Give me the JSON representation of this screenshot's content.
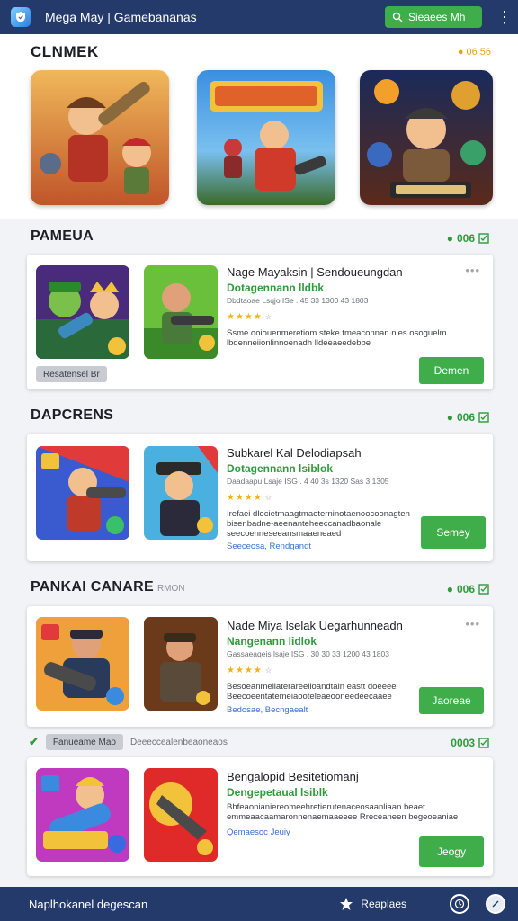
{
  "topbar": {
    "title": "Mega May | Gamebananas",
    "button_label": "Sieaees Mh",
    "menu_icon": "kebab-icon"
  },
  "featured": {
    "title": "CLNMEK",
    "count": "06 56"
  },
  "sections": [
    {
      "title": "PAMEUA",
      "subtitle": "",
      "badge": "006",
      "card": {
        "title": "Nage Mayaksin | Sendoueungdan",
        "sub": "Dotagennann lldbk",
        "meta": "Dbdtaoae Lsqjo  ISe . 45 33  1300  43 1803",
        "stars": "★★★★",
        "stars_count": "☆",
        "desc": "Ssme ooiouenmeretiom steke tmeaconnan nies osoguelm lbdenneiionlinnoenadh lldeeaeedebbe",
        "link": "",
        "button": "Demen",
        "pill": "Resatensel Br"
      }
    },
    {
      "title": "DAPCRENS",
      "subtitle": "",
      "badge": "006",
      "card": {
        "title": "Subkarel Kal Delodiapsah",
        "sub": "Dotagennann lsiblok",
        "meta": "Daadaapu  Lsaje ISG . 4 40 3s 1320  Sas 3 1305",
        "stars": "★★★★",
        "stars_count": "☆",
        "desc": "Irefaei dlocietmaagtmaeterninotaenoocoonagten bisenbadne-aeenanteheeccanadbaonale seecoenneseeansmaaeneaed",
        "link": "Seeceosa, Rendgandt",
        "button": "Semey",
        "pill": ""
      }
    },
    {
      "title": "PANKAI CANARE",
      "subtitle": "RMON",
      "badge": "006",
      "card": {
        "title": "Nade Miya lselak Uegarhunneadn",
        "sub": "Nangenann lidlok",
        "meta": "Gassaeaqeis  lsaje ISG . 30 30 33 1200  43 1803",
        "stars": "★★★★",
        "stars_count": "☆",
        "desc": "Besoeanmeliaterareelloandtain eastt doeeee Beecoeentatemeiaooteleaeooneedeecaaee",
        "link": "Bedosae, Becngaealt",
        "button": "Jaoreae",
        "pill": ""
      }
    },
    {
      "title": "",
      "subtitle": "",
      "badge": "0003",
      "card": {
        "title": "Bengalopid Besitetiomanj",
        "sub": "Dengepetaual lsiblk",
        "meta": "",
        "stars": "",
        "stars_count": "",
        "desc": "Bhfeaonianiereomeehretierutenaceosaanliaan beaet emmeaacaamaronnenaemaaeeee Rreceaneen begeoeaniae",
        "link": "Qemaesoc Jeuiy",
        "button": "Jeogy",
        "pill": ""
      }
    }
  ],
  "mini_row": {
    "pill": "Fanueame Mao",
    "text": "Deeeccealenbeaoneaos"
  },
  "bottombar": {
    "label": "Naplhokanel degescan",
    "fav_label": "Reaplaes"
  }
}
